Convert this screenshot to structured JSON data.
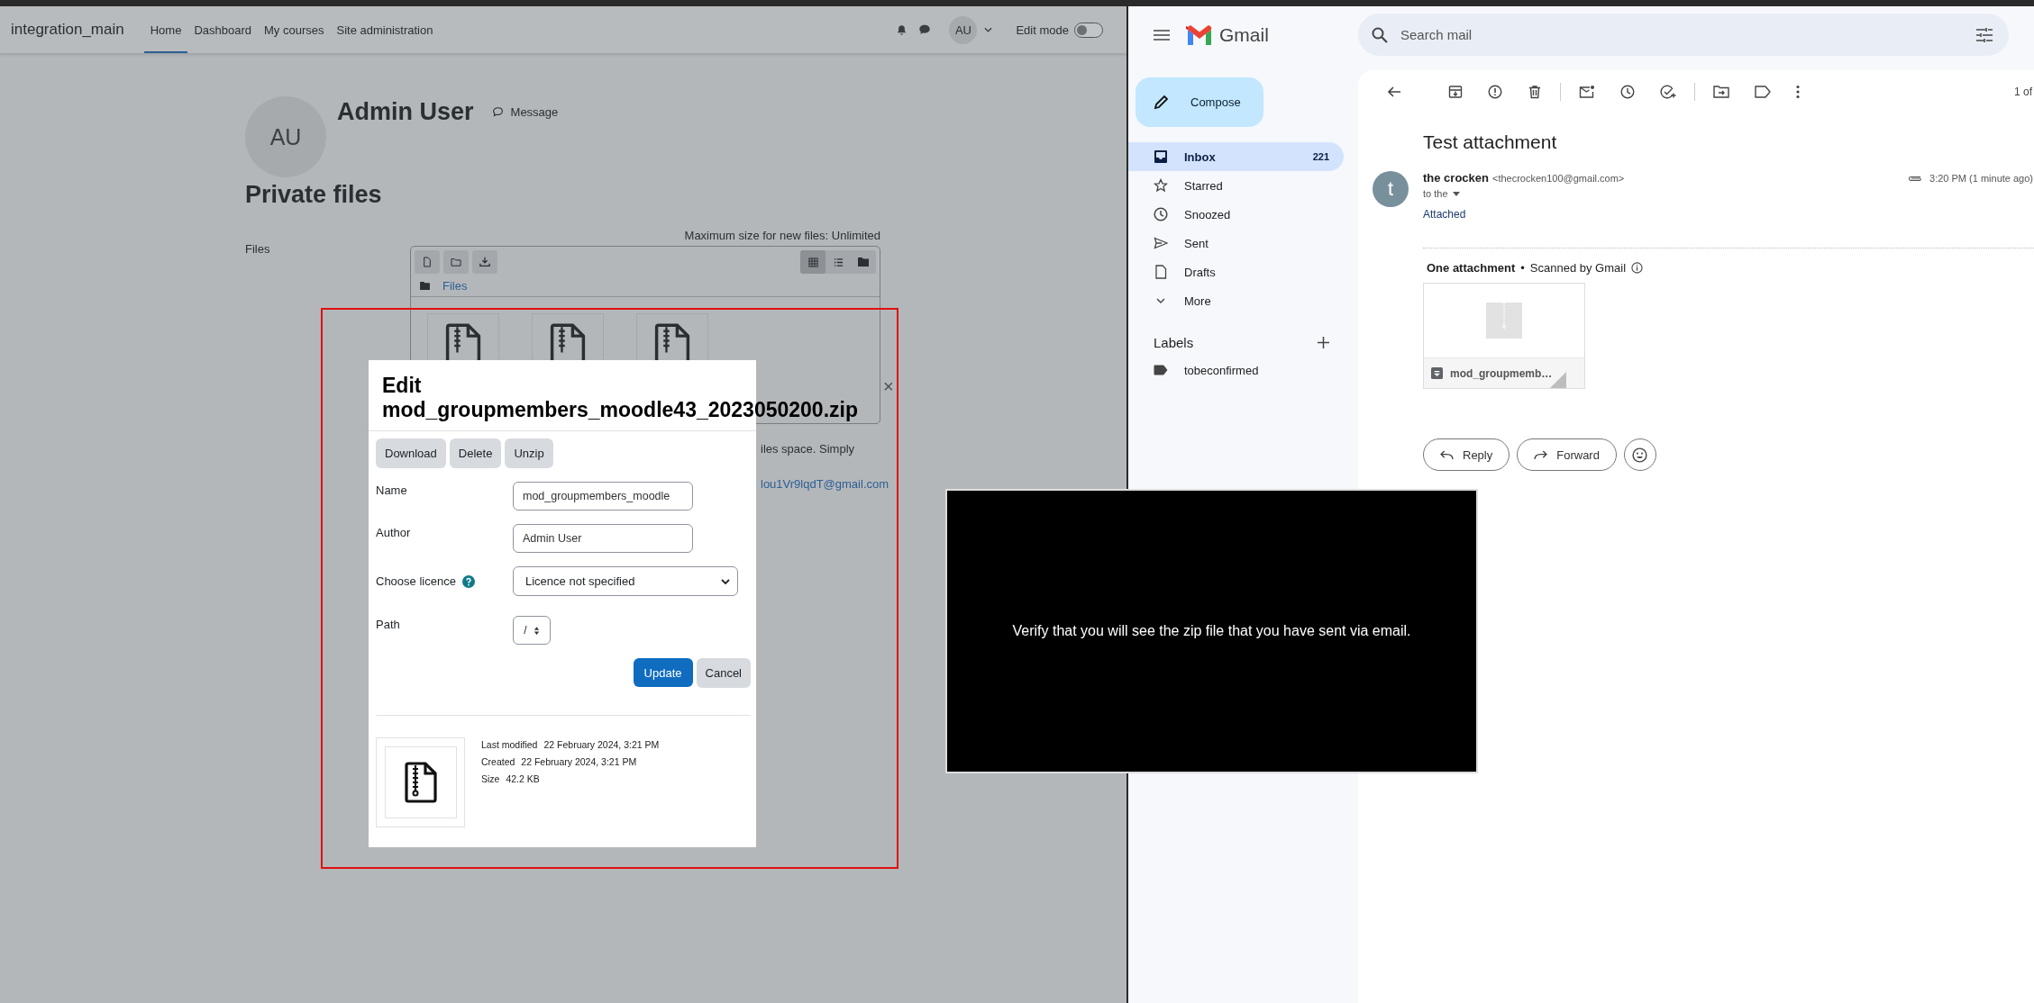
{
  "moodle": {
    "navbar": {
      "site_name": "integration_main",
      "links": [
        {
          "label": "Home",
          "selected": true
        },
        {
          "label": "Dashboard",
          "selected": false
        },
        {
          "label": "My courses",
          "selected": false
        },
        {
          "label": "Site administration",
          "selected": false
        }
      ],
      "user_initials": "AU",
      "edit_mode": {
        "label": "Edit mode",
        "on": false
      }
    },
    "profile": {
      "initials": "AU",
      "name": "Admin User",
      "message_link": "Message"
    },
    "page_title": "Private files",
    "files_label": "Files",
    "max_size": "Maximum size for new files: Unlimited",
    "file_manager": {
      "view_buttons": [
        {
          "kind": "icons",
          "selected": true
        },
        {
          "kind": "list",
          "selected": false
        },
        {
          "kind": "tree",
          "selected": false
        }
      ],
      "breadcrumb": "Files",
      "files": [
        {
          "kind": "zip"
        },
        {
          "kind": "zip"
        },
        {
          "kind": "zip"
        }
      ]
    },
    "partly_hidden_text": {
      "description_fragment": "iles space. Simply",
      "email_fragment": "lou1Vr9lqdT@gmail.com"
    },
    "dialog": {
      "title": "Edit mod_groupmembers_moodle43_2023050200.zip",
      "close": "×",
      "actions": [
        "Download",
        "Delete",
        "Unzip"
      ],
      "fields": [
        {
          "kind": "text",
          "label": "Name",
          "help": false,
          "value": "mod_groupmembers_moodle"
        },
        {
          "kind": "text",
          "label": "Author",
          "help": false,
          "value": "Admin User"
        },
        {
          "kind": "select",
          "label": "Choose licence",
          "help": true,
          "value": "Licence not specified"
        },
        {
          "kind": "spinner",
          "label": "Path",
          "help": false,
          "value": "/"
        }
      ],
      "buttons": [
        {
          "label": "Update",
          "kind": "primary"
        },
        {
          "label": "Cancel",
          "kind": "secondary"
        }
      ],
      "info": [
        {
          "label": "Last modified",
          "value": "22 February 2024, 3:21 PM"
        },
        {
          "label": "Created",
          "value": "22 February 2024, 3:21 PM"
        },
        {
          "label": "Size",
          "value": "42.2 KB"
        }
      ]
    }
  },
  "instruction_overlay": {
    "text": "Verify that you will see the zip file that you have sent via email."
  },
  "gmail": {
    "app_name": "Gmail",
    "search": {
      "placeholder": "Search mail"
    },
    "compose": "Compose",
    "folders": [
      {
        "kind": "inbox",
        "label": "Inbox",
        "count": "221",
        "selected": true
      },
      {
        "kind": "star",
        "label": "Starred",
        "selected": false
      },
      {
        "kind": "clock",
        "label": "Snoozed",
        "selected": false
      },
      {
        "kind": "send",
        "label": "Sent",
        "selected": false
      },
      {
        "kind": "draft",
        "label": "Drafts",
        "selected": false
      },
      {
        "kind": "more",
        "label": "More",
        "selected": false
      }
    ],
    "labels_heading": "Labels",
    "labels": [
      {
        "name": "tobeconfirmed"
      }
    ],
    "pagination": "1 of",
    "subject": "Test attachment",
    "message": {
      "sender_initial": "t",
      "sender_name": "the crocken",
      "sender_email": "<thecrocken100@gmail.com>",
      "recipient": "to the",
      "time": "3:20 PM (1 minute ago)",
      "body": "Attached"
    },
    "attachments": {
      "heading": "One attachment",
      "separator": "•",
      "scan_note": "Scanned by Gmail",
      "files": [
        {
          "name": "mod_groupmemb…"
        }
      ]
    },
    "reply_buttons": [
      {
        "kind": "reply",
        "label": "Reply"
      },
      {
        "kind": "forward",
        "label": "Forward"
      }
    ]
  }
}
